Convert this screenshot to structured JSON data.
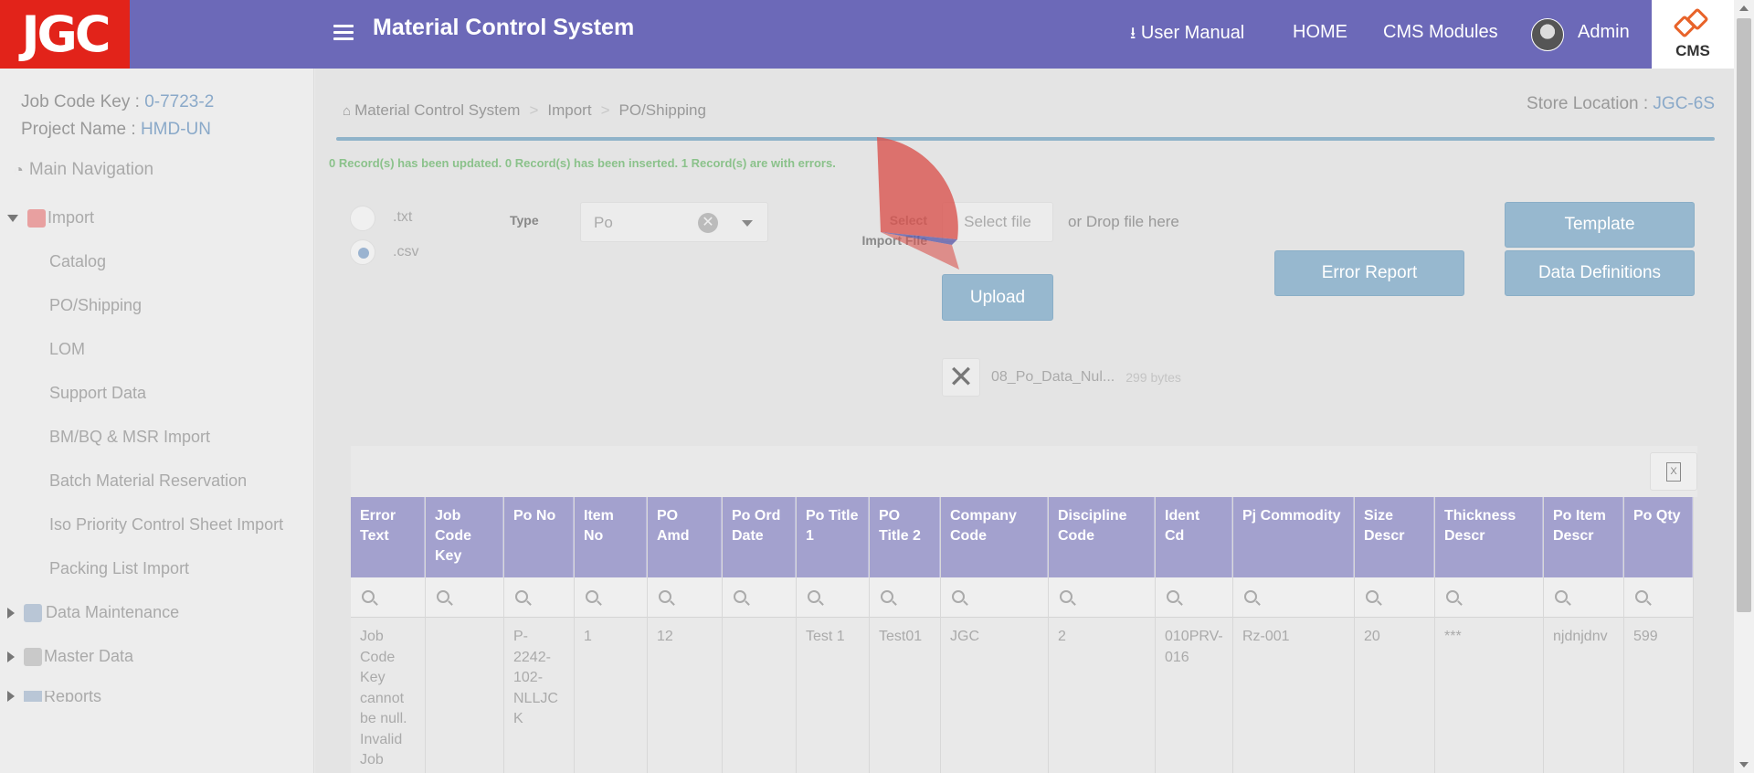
{
  "header": {
    "logo": "JGC",
    "title": "Material Control System",
    "user_manual": "User Manual",
    "home": "HOME",
    "cms_modules": "CMS Modules",
    "user": "Admin",
    "cms_logo": "CMS"
  },
  "sidebar": {
    "job_code_label": "Job Code Key : ",
    "job_code_value": "0-7723-2",
    "project_label": "Project Name : ",
    "project_value": "HMD-UN",
    "main_navigation": "Main Navigation",
    "import_group": "Import",
    "import_items": [
      "Catalog",
      "PO/Shipping",
      "LOM",
      "Support Data",
      "BM/BQ & MSR Import",
      "Batch Material Reservation",
      "Iso Priority Control Sheet Import",
      "Packing List Import"
    ],
    "data_maintenance": "Data Maintenance",
    "master_data": "Master Data",
    "reports": "Reports"
  },
  "content": {
    "breadcrumb": [
      "Material Control System",
      "Import",
      "PO/Shipping"
    ],
    "store_label": "Store Location : ",
    "store_value": "JGC-6S",
    "message": "0 Record(s) has been updated. 0 Record(s) has been inserted. 1 Record(s) are with errors.",
    "radio_txt": ".txt",
    "radio_csv": ".csv",
    "radio_selected": ".csv",
    "type_label": "Type",
    "type_value": "Po",
    "select_label_1": "Select",
    "select_label_2": "Import File",
    "select_file": "Select file",
    "drop_text": "or Drop file here",
    "upload": "Upload",
    "error_report": "Error Report",
    "template": "Template",
    "data_definitions": "Data Definitions",
    "file_name": "08_Po_Data_Nul...",
    "file_size": "299 bytes",
    "excel_icon_text": "X"
  },
  "grid": {
    "columns": [
      {
        "header": "Error Text",
        "value": "Job Code Key cannot be null. Invalid Job"
      },
      {
        "header": "Job Code Key",
        "value": ""
      },
      {
        "header": "Po No",
        "value": "P-2242-102-NLLJCK"
      },
      {
        "header": "Item No",
        "value": "1"
      },
      {
        "header": "PO Amd",
        "value": "12"
      },
      {
        "header": "Po Ord Date",
        "value": ""
      },
      {
        "header": "Po Title 1",
        "value": "Test 1"
      },
      {
        "header": "PO Title 2",
        "value": "Test01"
      },
      {
        "header": "Company Code",
        "value": "JGC"
      },
      {
        "header": "Discipline Code",
        "value": "2"
      },
      {
        "header": "Ident Cd",
        "value": "010PRV-016"
      },
      {
        "header": "Pj Commodity",
        "value": "Rz-001"
      },
      {
        "header": "Size Descr",
        "value": "20"
      },
      {
        "header": "Thickness Descr",
        "value": "***"
      },
      {
        "header": "Po Item Descr",
        "value": "njdnjdnv"
      },
      {
        "header": "Po Qty",
        "value": "599"
      }
    ]
  },
  "colors": {
    "header_bg": "#6c69b8",
    "logo_red": "#e2231a",
    "grid_header": "#a3a1ce",
    "button": "#97b8cf",
    "message_green": "#8bc28b"
  }
}
